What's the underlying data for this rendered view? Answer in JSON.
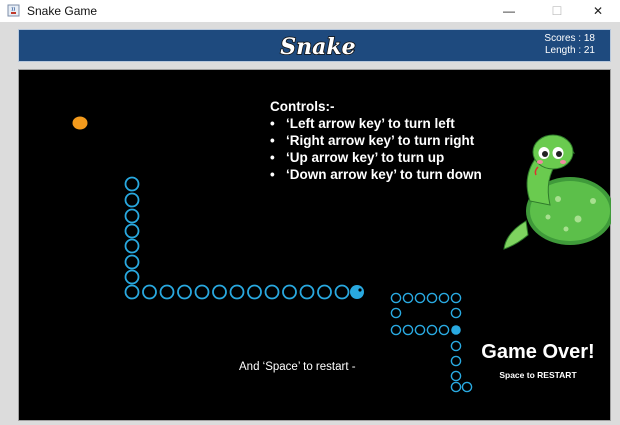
{
  "window": {
    "title": "Snake Game",
    "minimize_label": "—",
    "maximize_label": "☐",
    "close_label": "✕"
  },
  "header": {
    "logo": "Snake",
    "scores_label": "Scores : 18",
    "length_label": "Length : 21"
  },
  "board": {
    "controls_title": "Controls:-",
    "controls": [
      "‘Left arrow key’ to turn left",
      "‘Right arrow key’ to turn right",
      "‘Up arrow key’ to turn up",
      "‘Down arrow key’ to turn down"
    ],
    "restart_hint": "And ‘Space’ to restart -",
    "game_over_title": "Game Over!",
    "game_over_subtitle": "Space to RESTART"
  },
  "colors": {
    "board_background": "#000000",
    "header_background": "#1e4a7e",
    "snake_segment": "#29a9e0",
    "snake_head": "#29a9e0",
    "food": "#f39a1c",
    "text": "#ffffff"
  },
  "icons": {
    "app": "java-cup-icon",
    "mascot": "green-snake-mascot"
  }
}
